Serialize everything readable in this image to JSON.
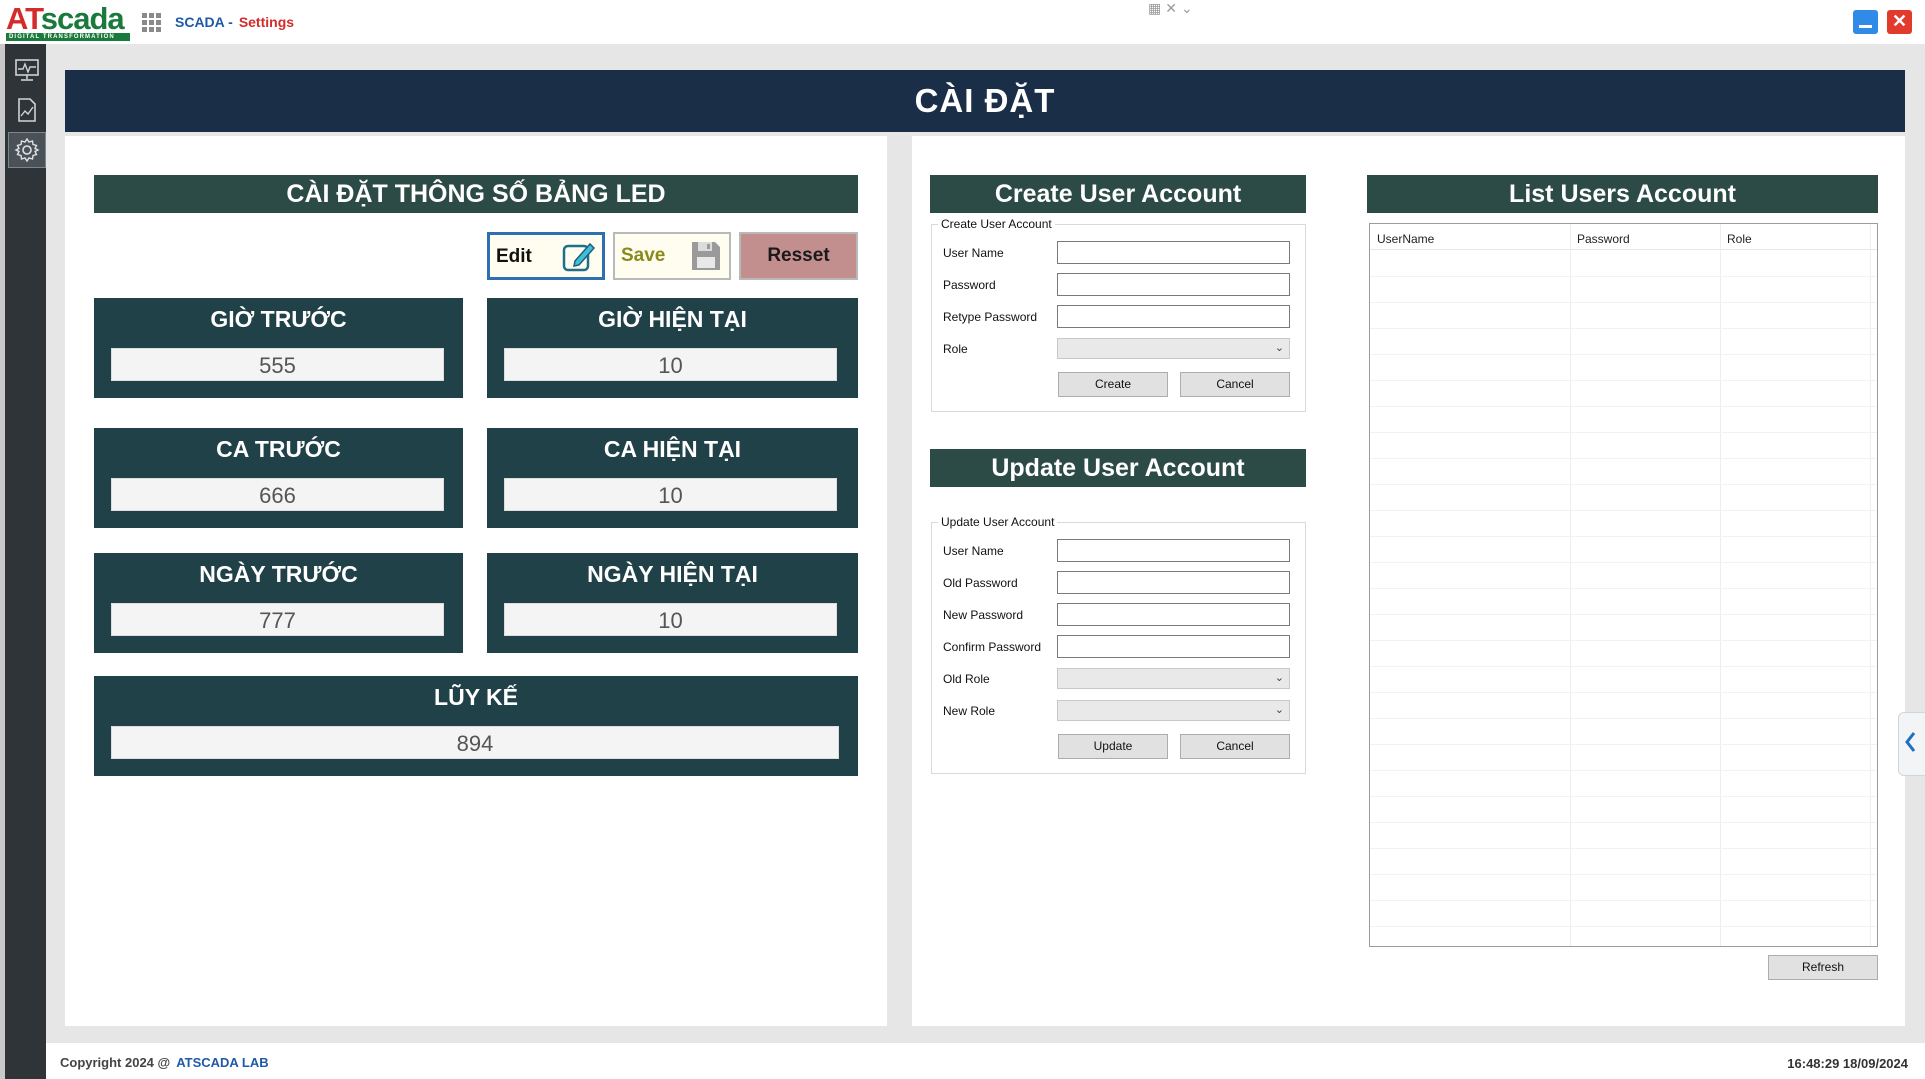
{
  "app": {
    "logo_main_at": "AT",
    "logo_main_scada": "scada",
    "logo_sub": "DIGITAL TRANSFORMATION",
    "title_prefix": "SCADA -",
    "title_page": "Settings",
    "icons": {
      "apps": "grid-icon",
      "minimize": "minimize-icon",
      "close": "close-icon",
      "monitor": "monitor-icon",
      "report": "chart-report-icon",
      "settings": "gear-icon"
    },
    "colors": {
      "header_navy": "#1b2e48",
      "section_green": "#2c4b46",
      "card_green": "#1f4147",
      "brand_red": "#d42b2b",
      "brand_blue": "#1e5aa8"
    }
  },
  "main": {
    "title": "CÀI ĐẶT"
  },
  "led": {
    "header": "CÀI ĐẶT THÔNG SỐ BẢNG LED",
    "buttons": {
      "edit": "Edit",
      "save": "Save",
      "reset": "Resset"
    },
    "cards": [
      {
        "label": "GIỜ TRƯỚC",
        "value": "555"
      },
      {
        "label": "GIỜ HIỆN TẠI",
        "value": "10"
      },
      {
        "label": "CA TRƯỚC",
        "value": "666"
      },
      {
        "label": "CA HIỆN TẠI",
        "value": "10"
      },
      {
        "label": "NGÀY TRƯỚC",
        "value": "777"
      },
      {
        "label": "NGÀY HIỆN TẠI",
        "value": "10"
      },
      {
        "label": "LŨY KẾ",
        "value": "894"
      }
    ]
  },
  "create_user": {
    "header": "Create User Account",
    "group": "Create User Account",
    "fields": [
      "User Name",
      "Password",
      "Retype Password",
      "Role"
    ],
    "create_btn": "Create",
    "cancel_btn": "Cancel"
  },
  "update_user": {
    "header": "Update User Account",
    "group": "Update User Account",
    "fields": [
      "User Name",
      "Old Password",
      "New Password",
      "Confirm Password",
      "Old Role",
      "New Role"
    ],
    "update_btn": "Update",
    "cancel_btn": "Cancel"
  },
  "list_users": {
    "header": "List Users Account",
    "columns": [
      "UserName",
      "Password",
      "Role"
    ],
    "refresh_btn": "Refresh"
  },
  "footer": {
    "copyright": "Copyright 2024 @",
    "lab": "ATSCADA LAB",
    "clock": "16:48:29 18/09/2024"
  }
}
